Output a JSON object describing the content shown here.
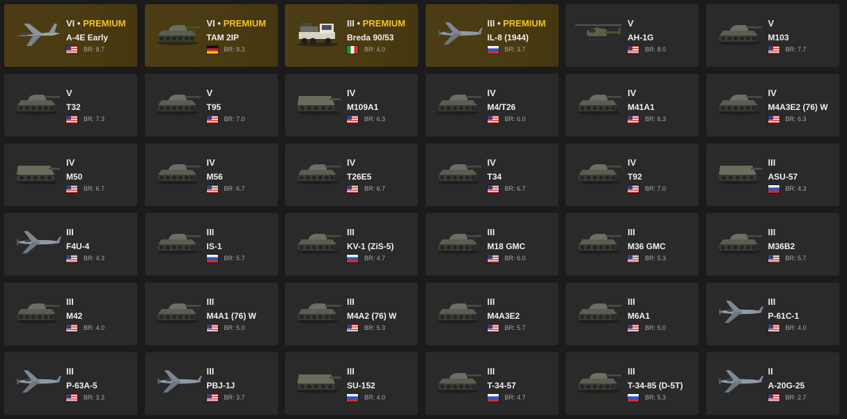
{
  "colors": {
    "background": "#1b1b1c",
    "card": "#2a2a2b",
    "premium_card": "#4a3b12",
    "premium_accent": "#f6c324"
  },
  "vehicles": [
    {
      "tier": "VI",
      "premium": true,
      "premium_label": "PREMIUM",
      "name": "A-4E Early",
      "nation": "usa",
      "br": "BR: 8.7",
      "kind": "jet"
    },
    {
      "tier": "VI",
      "premium": true,
      "premium_label": "PREMIUM",
      "name": "TAM 2IP",
      "nation": "germany",
      "br": "BR: 9.3",
      "kind": "tank"
    },
    {
      "tier": "III",
      "premium": true,
      "premium_label": "PREMIUM",
      "name": "Breda 90/53",
      "nation": "italy",
      "br": "BR: 4.0",
      "kind": "truck"
    },
    {
      "tier": "III",
      "premium": true,
      "premium_label": "PREMIUM",
      "name": "IL-8 (1944)",
      "nation": "ussr",
      "br": "BR: 3.7",
      "kind": "plane"
    },
    {
      "tier": "V",
      "premium": false,
      "name": "AH-1G",
      "nation": "usa",
      "br": "BR: 8.0",
      "kind": "heli"
    },
    {
      "tier": "V",
      "premium": false,
      "name": "M103",
      "nation": "usa",
      "br": "BR: 7.7",
      "kind": "tank"
    },
    {
      "tier": "V",
      "premium": false,
      "name": "T32",
      "nation": "usa",
      "br": "BR: 7.3",
      "kind": "tank"
    },
    {
      "tier": "V",
      "premium": false,
      "name": "T95",
      "nation": "usa",
      "br": "BR: 7.0",
      "kind": "tank"
    },
    {
      "tier": "IV",
      "premium": false,
      "name": "M109A1",
      "nation": "usa",
      "br": "BR: 6.3",
      "kind": "spg"
    },
    {
      "tier": "IV",
      "premium": false,
      "name": "M4/T26",
      "nation": "usa",
      "br": "BR: 6.0",
      "kind": "tank"
    },
    {
      "tier": "IV",
      "premium": false,
      "name": "M41A1",
      "nation": "usa",
      "br": "BR: 6.3",
      "kind": "tank"
    },
    {
      "tier": "IV",
      "premium": false,
      "name": "M4A3E2 (76) W",
      "nation": "usa",
      "br": "BR: 6.3",
      "kind": "tank"
    },
    {
      "tier": "IV",
      "premium": false,
      "name": "M50",
      "nation": "usa",
      "br": "BR: 6.7",
      "kind": "spg"
    },
    {
      "tier": "IV",
      "premium": false,
      "name": "M56",
      "nation": "usa",
      "br": "BR: 6.7",
      "kind": "tank"
    },
    {
      "tier": "IV",
      "premium": false,
      "name": "T26E5",
      "nation": "usa",
      "br": "BR: 6.7",
      "kind": "tank"
    },
    {
      "tier": "IV",
      "premium": false,
      "name": "T34",
      "nation": "usa",
      "br": "BR: 6.7",
      "kind": "tank"
    },
    {
      "tier": "IV",
      "premium": false,
      "name": "T92",
      "nation": "usa",
      "br": "BR: 7.0",
      "kind": "tank"
    },
    {
      "tier": "III",
      "premium": false,
      "name": "ASU-57",
      "nation": "ussr",
      "br": "BR: 4.3",
      "kind": "spg"
    },
    {
      "tier": "III",
      "premium": false,
      "name": "F4U-4",
      "nation": "usa",
      "br": "BR: 4.3",
      "kind": "plane"
    },
    {
      "tier": "III",
      "premium": false,
      "name": "IS-1",
      "nation": "ussr",
      "br": "BR: 5.7",
      "kind": "tank"
    },
    {
      "tier": "III",
      "premium": false,
      "name": "KV-1 (ZiS-5)",
      "nation": "ussr",
      "br": "BR: 4.7",
      "kind": "tank"
    },
    {
      "tier": "III",
      "premium": false,
      "name": "M18 GMC",
      "nation": "usa",
      "br": "BR: 6.0",
      "kind": "tank"
    },
    {
      "tier": "III",
      "premium": false,
      "name": "M36 GMC",
      "nation": "usa",
      "br": "BR: 5.3",
      "kind": "tank"
    },
    {
      "tier": "III",
      "premium": false,
      "name": "M36B2",
      "nation": "usa",
      "br": "BR: 5.7",
      "kind": "tank"
    },
    {
      "tier": "III",
      "premium": false,
      "name": "M42",
      "nation": "usa",
      "br": "BR: 4.0",
      "kind": "tank"
    },
    {
      "tier": "III",
      "premium": false,
      "name": "M4A1 (76) W",
      "nation": "usa",
      "br": "BR: 5.0",
      "kind": "tank"
    },
    {
      "tier": "III",
      "premium": false,
      "name": "M4A2 (76) W",
      "nation": "usa",
      "br": "BR: 5.3",
      "kind": "tank"
    },
    {
      "tier": "III",
      "premium": false,
      "name": "M4A3E2",
      "nation": "usa",
      "br": "BR: 5.7",
      "kind": "tank"
    },
    {
      "tier": "III",
      "premium": false,
      "name": "M6A1",
      "nation": "usa",
      "br": "BR: 5.0",
      "kind": "tank"
    },
    {
      "tier": "III",
      "premium": false,
      "name": "P-61C-1",
      "nation": "usa",
      "br": "BR: 4.0",
      "kind": "plane"
    },
    {
      "tier": "III",
      "premium": false,
      "name": "P-63A-5",
      "nation": "usa",
      "br": "BR: 3.3",
      "kind": "plane"
    },
    {
      "tier": "III",
      "premium": false,
      "name": "PBJ-1J",
      "nation": "usa",
      "br": "BR: 3.7",
      "kind": "plane"
    },
    {
      "tier": "III",
      "premium": false,
      "name": "SU-152",
      "nation": "ussr",
      "br": "BR: 4.0",
      "kind": "spg"
    },
    {
      "tier": "III",
      "premium": false,
      "name": "T-34-57",
      "nation": "ussr",
      "br": "BR: 4.7",
      "kind": "tank"
    },
    {
      "tier": "III",
      "premium": false,
      "name": "T-34-85 (D-5T)",
      "nation": "ussr",
      "br": "BR: 5.3",
      "kind": "tank"
    },
    {
      "tier": "II",
      "premium": false,
      "name": "A-20G-25",
      "nation": "usa",
      "br": "BR: 2.7",
      "kind": "plane"
    }
  ]
}
